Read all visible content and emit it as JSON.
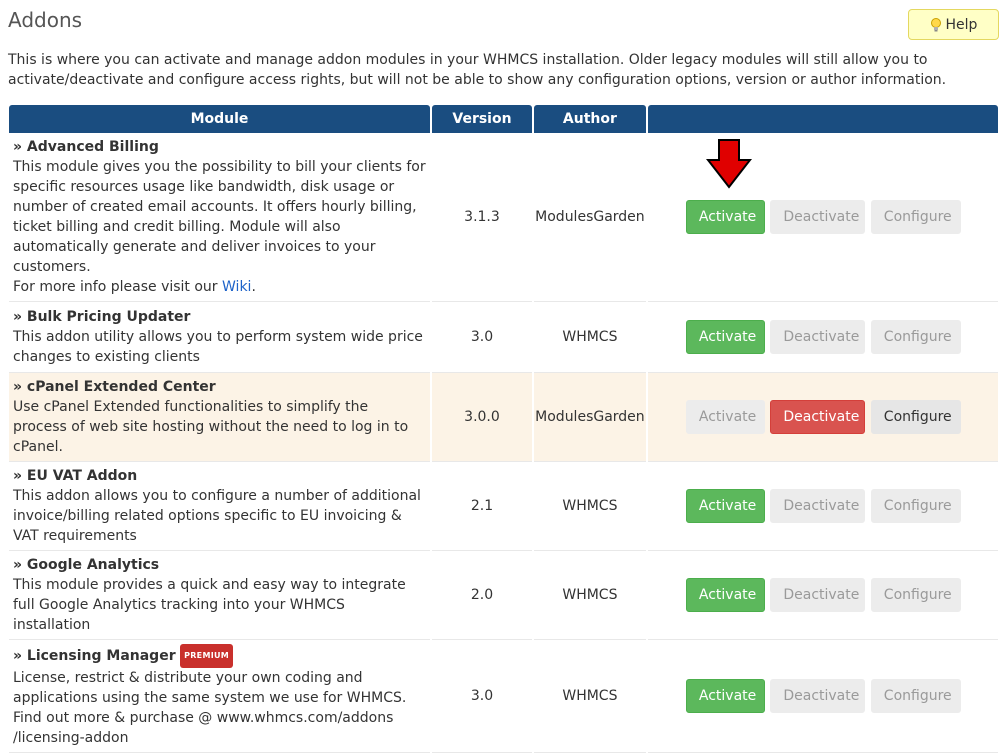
{
  "page": {
    "title": "Addons",
    "help_label": "Help",
    "intro": "This is where you can activate and manage addon modules in your WHMCS installation. Older legacy modules will still allow you to activate/deactivate and configure access rights, but will not be able to show any configuration options, version or author information."
  },
  "table": {
    "headers": {
      "module": "Module",
      "version": "Version",
      "author": "Author",
      "actions": ""
    },
    "buttons": {
      "activate": "Activate",
      "deactivate": "Deactivate",
      "configure": "Configure"
    },
    "rows": [
      {
        "name": "» Advanced Billing",
        "description": "This module gives you the possibility to bill your clients for specific resources usage like bandwidth, disk usage or number of created email accounts. It offers hourly billing, ticket billing and credit billing. Module will also automatically generate and deliver invoices to your customers.",
        "more_prefix": "For more info please visit our ",
        "more_link": "Wiki",
        "more_suffix": ".",
        "version": "3.1.3",
        "author": "ModulesGarden",
        "status": "inactive"
      },
      {
        "name": "» Bulk Pricing Updater",
        "description": "This addon utility allows you to perform system wide price changes to existing clients",
        "version": "3.0",
        "author": "WHMCS",
        "status": "inactive"
      },
      {
        "name": "» cPanel Extended Center",
        "description": "Use cPanel Extended functionalities to simplify the process of web site hosting without the need to log in to cPanel.",
        "version": "3.0.0",
        "author": "ModulesGarden",
        "status": "active"
      },
      {
        "name": "» EU VAT Addon",
        "description": "This addon allows you to configure a number of additional invoice/billing related options specific to EU invoicing & VAT requirements",
        "version": "2.1",
        "author": "WHMCS",
        "status": "inactive"
      },
      {
        "name": "» Google Analytics",
        "description": "This module provides a quick and easy way to integrate full Google Analytics tracking into your WHMCS installation",
        "version": "2.0",
        "author": "WHMCS",
        "status": "inactive"
      },
      {
        "name": "» Licensing Manager",
        "badge": "PREMIUM",
        "description": "License, restrict & distribute your own coding and applications using the same system we use for WHMCS.",
        "more_line1": "Find out more & purchase @ www.whmcs.com/addons",
        "more_line2": "/licensing-addon",
        "version": "3.0",
        "author": "WHMCS",
        "status": "inactive"
      }
    ]
  },
  "colors": {
    "header_bg": "#1a4d80",
    "activate_green": "#5cb85c",
    "deactivate_red": "#d9534f",
    "active_row_bg": "#fcf3e6",
    "annotation_arrow": "#e00000"
  },
  "icons": {
    "help": "lightbulb-icon",
    "annotation": "down-arrow-icon"
  }
}
